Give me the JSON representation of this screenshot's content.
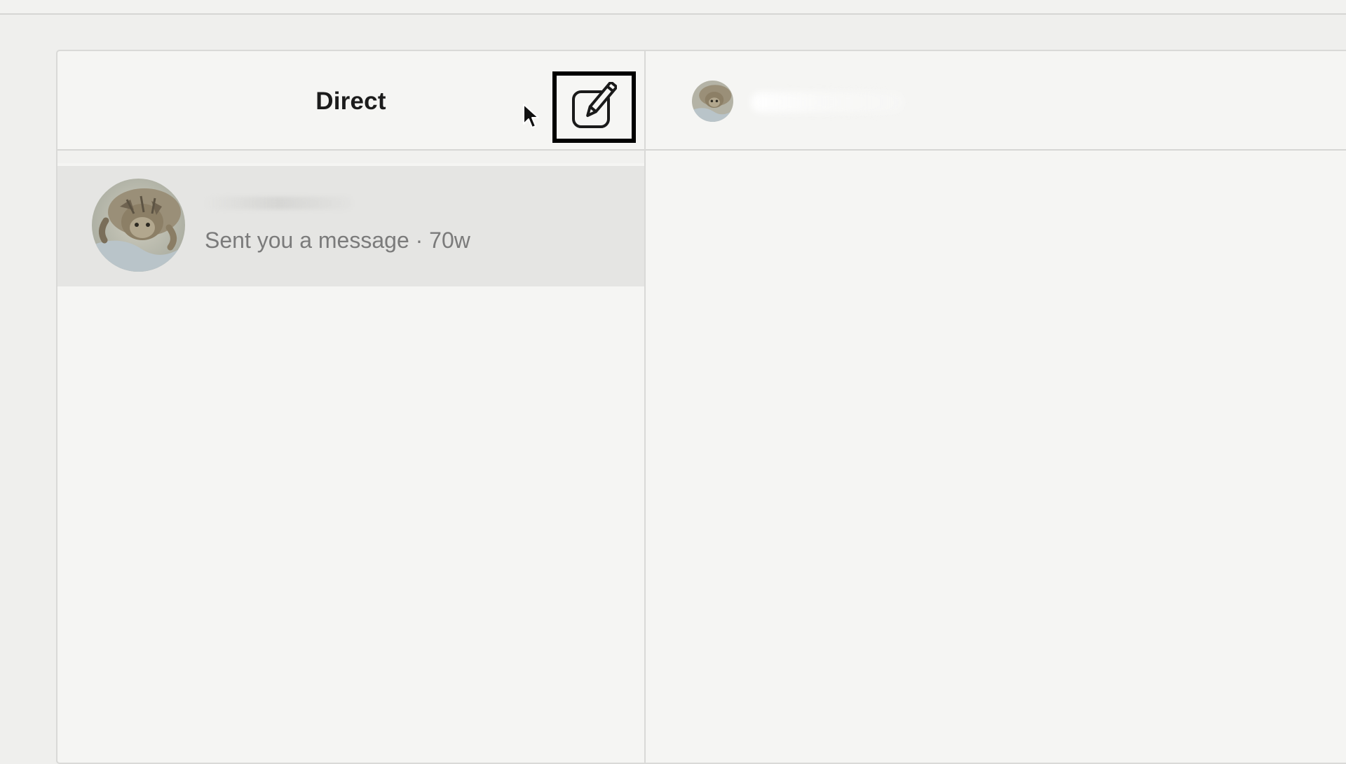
{
  "inbox": {
    "title": "Direct",
    "compose_icon": "compose-icon",
    "threads": [
      {
        "avatar_icon": "cat-avatar",
        "preview": "Sent you a message · 70w"
      }
    ]
  },
  "chat": {
    "avatar_icon": "cat-avatar"
  },
  "cursor_icon": "pointer-cursor-icon"
}
